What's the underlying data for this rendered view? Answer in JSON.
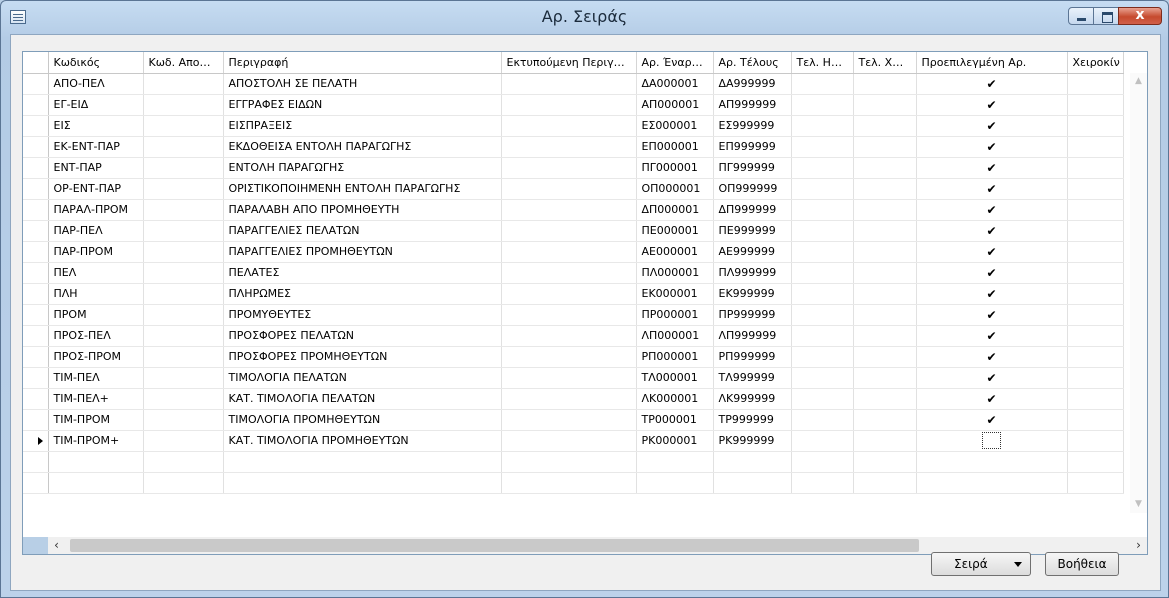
{
  "window": {
    "title": "Αρ. Σειράς",
    "close_glyph": "x"
  },
  "columns": [
    "Κωδικός",
    "Κωδ. Απο…",
    "Περιγραφή",
    "Εκτυπούμενη Περιγ…",
    "Αρ. Έναρ…",
    "Αρ. Τέλους",
    "Τελ. Η…",
    "Τελ. Χ…",
    "Προεπιλεγμένη Αρ.",
    "Χειροκίν"
  ],
  "rows": [
    {
      "code": "ΑΠΟ-ΠΕΛ",
      "desc": "ΑΠΟΣΤΟΛΗ ΣΕ ΠΕΛΑΤΗ",
      "start": "ΔΑ000001",
      "end": "ΔΑ999999",
      "default": "✔"
    },
    {
      "code": "ΕΓ-ΕΙΔ",
      "desc": "ΕΓΓΡΑΦΕΣ ΕΙΔΩΝ",
      "start": "ΑΠ000001",
      "end": "ΑΠ999999",
      "default": "✔"
    },
    {
      "code": "ΕΙΣ",
      "desc": "ΕΙΣΠΡΑΞΕΙΣ",
      "start": "ΕΣ000001",
      "end": "ΕΣ999999",
      "default": "✔"
    },
    {
      "code": "ΕΚ-ΕΝΤ-ΠΑΡ",
      "desc": "ΕΚΔΟΘΕΙΣΑ ΕΝΤΟΛΗ ΠΑΡΑΓΩΓΗΣ",
      "start": "ΕΠ000001",
      "end": "ΕΠ999999",
      "default": "✔"
    },
    {
      "code": "ΕΝΤ-ΠΑΡ",
      "desc": "ΕΝΤΟΛΗ ΠΑΡΑΓΩΓΗΣ",
      "start": "ΠΓ000001",
      "end": "ΠΓ999999",
      "default": "✔"
    },
    {
      "code": "ΟΡ-ΕΝΤ-ΠΑΡ",
      "desc": "ΟΡΙΣΤΙΚΟΠΟΙΗΜΕΝΗ ΕΝΤΟΛΗ ΠΑΡΑΓΩΓΗΣ",
      "start": "ΟΠ000001",
      "end": "ΟΠ999999",
      "default": "✔"
    },
    {
      "code": "ΠΑΡΑΛ-ΠΡΟΜ",
      "desc": "ΠΑΡΑΛΑΒΗ ΑΠΟ ΠΡΟΜΗΘΕΥΤΗ",
      "start": "ΔΠ000001",
      "end": "ΔΠ999999",
      "default": "✔"
    },
    {
      "code": "ΠΑΡ-ΠΕΛ",
      "desc": "ΠΑΡΑΓΓΕΛΙΕΣ ΠΕΛΑΤΩΝ",
      "start": "ΠΕ000001",
      "end": "ΠΕ999999",
      "default": "✔"
    },
    {
      "code": "ΠΑΡ-ΠΡΟΜ",
      "desc": "ΠΑΡΑΓΓΕΛΙΕΣ ΠΡΟΜΗΘΕΥΤΩΝ",
      "start": "ΑΕ000001",
      "end": "ΑΕ999999",
      "default": "✔"
    },
    {
      "code": "ΠΕΛ",
      "desc": "ΠΕΛΑΤΕΣ",
      "start": "ΠΛ000001",
      "end": "ΠΛ999999",
      "default": "✔"
    },
    {
      "code": "ΠΛΗ",
      "desc": "ΠΛΗΡΩΜΕΣ",
      "start": "ΕΚ000001",
      "end": "ΕΚ999999",
      "default": "✔"
    },
    {
      "code": "ΠΡΟΜ",
      "desc": "ΠΡΟΜΥΘΕΥΤΕΣ",
      "start": "ΠΡ000001",
      "end": "ΠΡ999999",
      "default": "✔"
    },
    {
      "code": "ΠΡΟΣ-ΠΕΛ",
      "desc": "ΠΡΟΣΦΟΡΕΣ ΠΕΛΑΤΩΝ",
      "start": "ΛΠ000001",
      "end": "ΛΠ999999",
      "default": "✔"
    },
    {
      "code": "ΠΡΟΣ-ΠΡΟΜ",
      "desc": "ΠΡΟΣΦΟΡΕΣ ΠΡΟΜΗΘΕΥΤΩΝ",
      "start": "ΡΠ000001",
      "end": "ΡΠ999999",
      "default": "✔"
    },
    {
      "code": "ΤΙΜ-ΠΕΛ",
      "desc": "ΤΙΜΟΛΟΓΙΑ ΠΕΛΑΤΩΝ",
      "start": "ΤΛ000001",
      "end": "ΤΛ999999",
      "default": "✔"
    },
    {
      "code": "ΤΙΜ-ΠΕΛ+",
      "desc": "ΚΑΤ. ΤΙΜΟΛΟΓΙΑ ΠΕΛΑΤΩΝ",
      "start": "ΛΚ000001",
      "end": "ΛΚ999999",
      "default": "✔"
    },
    {
      "code": "ΤΙΜ-ΠΡΟΜ",
      "desc": "ΤΙΜΟΛΟΓΙΑ ΠΡΟΜΗΘΕΥΤΩΝ",
      "start": "ΤΡ000001",
      "end": "ΤΡ999999",
      "default": "✔"
    },
    {
      "code": "ΤΙΜ-ΠΡΟΜ+",
      "desc": "ΚΑΤ. ΤΙΜΟΛΟΓΙΑ ΠΡΟΜΗΘΕΥΤΩΝ",
      "start": "ΡΚ000001",
      "end": "ΡΚ999999",
      "default": ""
    }
  ],
  "scroll": {
    "left": "‹",
    "right": "›",
    "up": "▲",
    "down": "▼"
  },
  "buttons": {
    "series": "Σειρά",
    "help": "Βοήθεια"
  }
}
